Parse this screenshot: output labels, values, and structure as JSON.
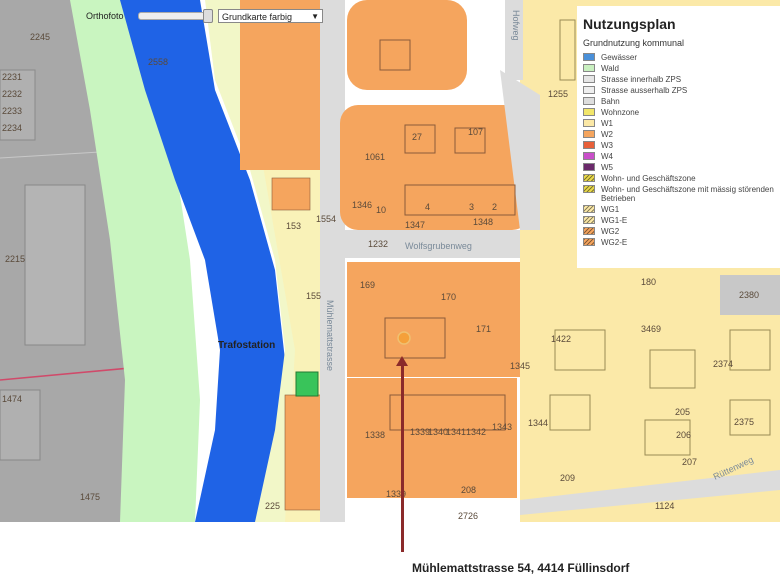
{
  "toolbar": {
    "layer_label": "Orthofoto",
    "basemap_value": "Grundkarte farbig"
  },
  "legend": {
    "title": "Nutzungsplan",
    "subtitle": "Grundnutzung kommunal",
    "items": [
      {
        "label": "Gewässer",
        "color": "#4a90d9",
        "hatch": false
      },
      {
        "label": "Wald",
        "color": "#c9f0c0",
        "hatch": false
      },
      {
        "label": "Strasse innerhalb ZPS",
        "color": "#e6e6e6",
        "hatch": false
      },
      {
        "label": "Strasse ausserhalb ZPS",
        "color": "#eeeeee",
        "hatch": false
      },
      {
        "label": "Bahn",
        "color": "#dddddd",
        "hatch": false
      },
      {
        "label": "Wohnzone",
        "color": "#f2e66a",
        "hatch": false
      },
      {
        "label": "W1",
        "color": "#fbe8a6",
        "hatch": false
      },
      {
        "label": "W2",
        "color": "#f5a55e",
        "hatch": false
      },
      {
        "label": "W3",
        "color": "#e8603a",
        "hatch": false
      },
      {
        "label": "W4",
        "color": "#c94fc9",
        "hatch": false
      },
      {
        "label": "W5",
        "color": "#6b2a6b",
        "hatch": false
      },
      {
        "label": "Wohn- und Geschäftszone",
        "color": "#e8d84a",
        "hatch": true
      },
      {
        "label": "Wohn- und Geschäftszone mit mässig störenden Betrieben",
        "color": "#e8d84a",
        "hatch": true
      },
      {
        "label": "WG1",
        "color": "#fbe8a6",
        "hatch": true
      },
      {
        "label": "WG1-E",
        "color": "#fbe8a6",
        "hatch": true
      },
      {
        "label": "WG2",
        "color": "#f5a55e",
        "hatch": true
      },
      {
        "label": "WG2-E",
        "color": "#f5a55e",
        "hatch": true
      }
    ]
  },
  "map": {
    "parcels": [
      "2245",
      "2231",
      "2232",
      "2233",
      "2234",
      "2215",
      "1474",
      "1475",
      "2558",
      "1255",
      "107",
      "1061",
      "1346",
      "1347",
      "1348",
      "1232",
      "153",
      "1554",
      "155",
      "169",
      "170",
      "171",
      "1422",
      "180",
      "2380",
      "3469",
      "2374",
      "1345",
      "1344",
      "1338",
      "1339",
      "1340",
      "1341",
      "1342",
      "1343",
      "1339",
      "205",
      "206",
      "207",
      "2375",
      "209",
      "208",
      "225",
      "2726",
      "1124",
      "27",
      "2",
      "3",
      "4",
      "10"
    ],
    "place_labels": [
      "Trafostation"
    ],
    "street_labels": [
      "Wolfsgrubenweg",
      "Mühlemattstrasse",
      "Hofweg",
      "Rüttenweg"
    ]
  },
  "marker": {
    "caption": "Mühlemattstrasse 54, 4414 Füllinsdorf"
  },
  "colors": {
    "pointer": "#8b2a2a",
    "water": "#1f63e6",
    "forest": "#c9f5c0",
    "w1": "#fbe9a8",
    "w2": "#f5a55e",
    "industry": "#9a9a9a"
  }
}
